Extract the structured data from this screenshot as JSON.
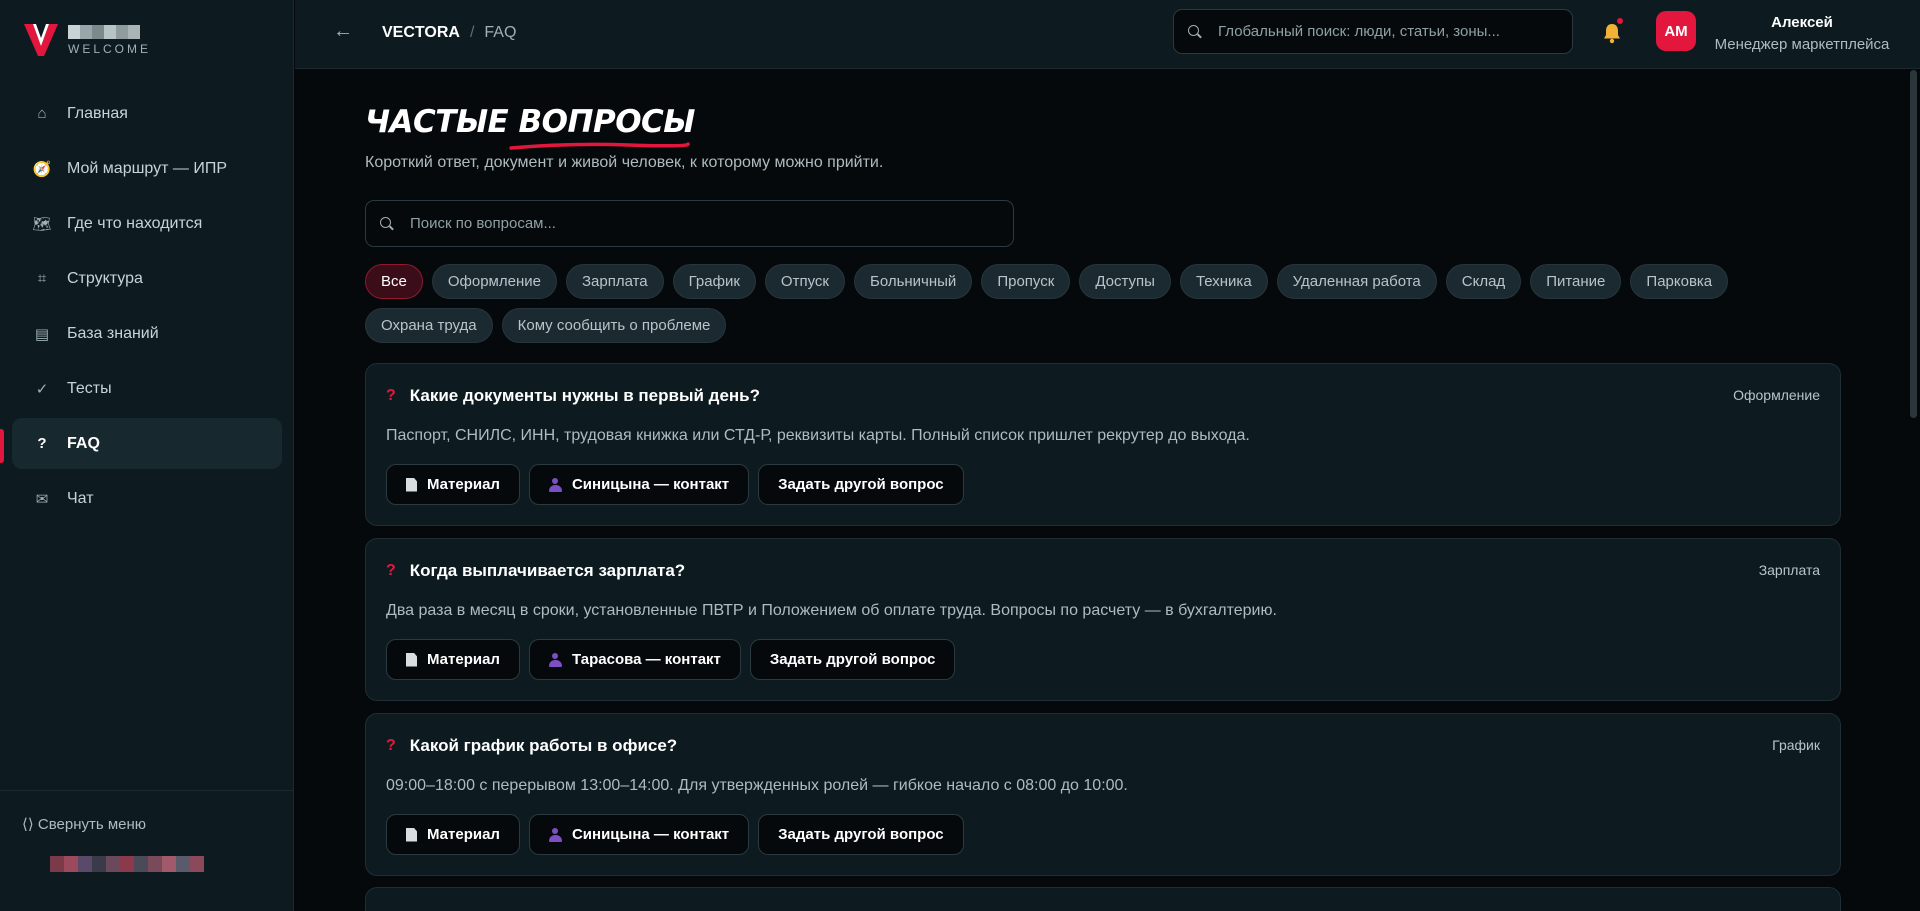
{
  "brand": {
    "welcome": "WELCOME",
    "accent": "#e3173e"
  },
  "sidebar": {
    "items": [
      {
        "label": "Главная",
        "icon": "home-icon",
        "glyph": "⌂"
      },
      {
        "label": "Мой маршрут — ИПР",
        "icon": "compass-icon",
        "glyph": "🧭"
      },
      {
        "label": "Где что находится",
        "icon": "map-icon",
        "glyph": "🗺"
      },
      {
        "label": "Структура",
        "icon": "structure-icon",
        "glyph": "⌗"
      },
      {
        "label": "База знаний",
        "icon": "book-icon",
        "glyph": "▤"
      },
      {
        "label": "Тесты",
        "icon": "check-icon",
        "glyph": "✓"
      },
      {
        "label": "FAQ",
        "icon": "question-icon",
        "glyph": "?"
      },
      {
        "label": "Чат",
        "icon": "mail-icon",
        "glyph": "✉"
      }
    ],
    "active": "FAQ",
    "collapse_label": "⟨⟩ Свернуть меню"
  },
  "topbar": {
    "back_glyph": "←",
    "breadcrumb_root": "VECTORA",
    "breadcrumb_sep": "/",
    "breadcrumb_current": "FAQ",
    "search_placeholder": "Глобальный поиск: люди, статьи, зоны...",
    "user": {
      "initials": "АМ",
      "name": "Алексей",
      "role": "Менеджер маркетплейса"
    }
  },
  "main": {
    "title_part1": "ЧАСТЫЕ",
    "title_part2": "ВОПРОСЫ",
    "subtitle": "Короткий ответ, документ и живой человек, к которому можно прийти.",
    "search_placeholder": "Поиск по вопросам...",
    "chips": [
      "Все",
      "Оформление",
      "Зарплата",
      "График",
      "Отпуск",
      "Больничный",
      "Пропуск",
      "Доступы",
      "Техника",
      "Удаленная работа",
      "Склад",
      "Питание",
      "Парковка",
      "Охрана труда",
      "Кому сообщить о проблеме"
    ],
    "active_chip": "Все",
    "cards": [
      {
        "question": "Какие документы нужны в первый день?",
        "category": "Оформление",
        "answer": "Паспорт, СНИЛС, ИНН, трудовая книжка или СТД-Р, реквизиты карты. Полный список пришлет рекрутер до выхода.",
        "material_label": "Материал",
        "contact_label": "Синицына — контакт",
        "ask_label": "Задать другой вопрос"
      },
      {
        "question": "Когда выплачивается зарплата?",
        "category": "Зарплата",
        "answer": "Два раза в месяц в сроки, установленные ПВТР и Положением об оплате труда. Вопросы по расчету — в бухгалтерию.",
        "material_label": "Материал",
        "contact_label": "Тарасова — контакт",
        "ask_label": "Задать другой вопрос"
      },
      {
        "question": "Какой график работы в офисе?",
        "category": "График",
        "answer": "09:00–18:00 с перерывом 13:00–14:00. Для утвержденных ролей — гибкое начало с 08:00 до 10:00.",
        "material_label": "Материал",
        "contact_label": "Синицына — контакт",
        "ask_label": "Задать другой вопрос"
      }
    ]
  }
}
